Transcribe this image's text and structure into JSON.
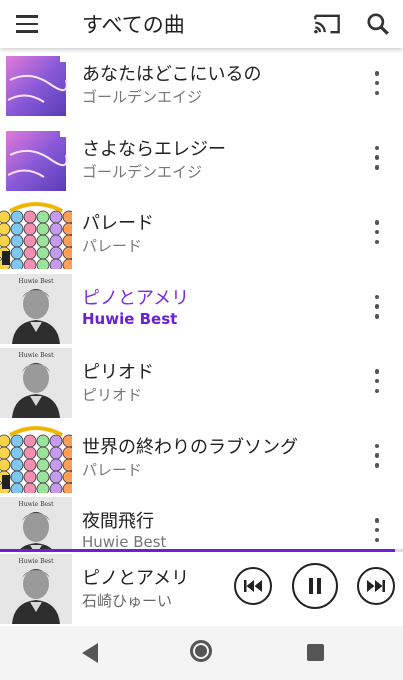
{
  "appbar": {
    "title": "すべての曲"
  },
  "songs": [
    {
      "title": "あなたはどこにいるの",
      "subtitle": "ゴールデンエイジ",
      "art": "purple-sky"
    },
    {
      "title": "さよならエレジー",
      "subtitle": "ゴールデンエイジ",
      "art": "purple-sky"
    },
    {
      "title": "パレード",
      "subtitle": "パレード",
      "art": "parade"
    },
    {
      "title": "ピノとアメリ",
      "subtitle": "Huwie Best",
      "art": "huwie",
      "playing": true
    },
    {
      "title": "ピリオド",
      "subtitle": "ピリオド",
      "art": "huwie"
    },
    {
      "title": "世界の終わりのラブソング",
      "subtitle": "パレード",
      "art": "parade"
    },
    {
      "title": "夜間飛行",
      "subtitle": "Huwie Best",
      "art": "huwie"
    }
  ],
  "art_labels": {
    "huwie": "Huwie Best"
  },
  "now_playing": {
    "title": "ピノとアメリ",
    "artist": "石崎ひゅーい",
    "progress": 0.98
  },
  "colors": {
    "accent": "#6a1fd8",
    "playing_title": "#7a2de0"
  },
  "icons": [
    "menu-icon",
    "cast-icon",
    "search-icon",
    "more-vert-icon",
    "skip-previous-icon",
    "pause-icon",
    "skip-next-icon",
    "back-icon",
    "home-icon",
    "recents-icon"
  ]
}
